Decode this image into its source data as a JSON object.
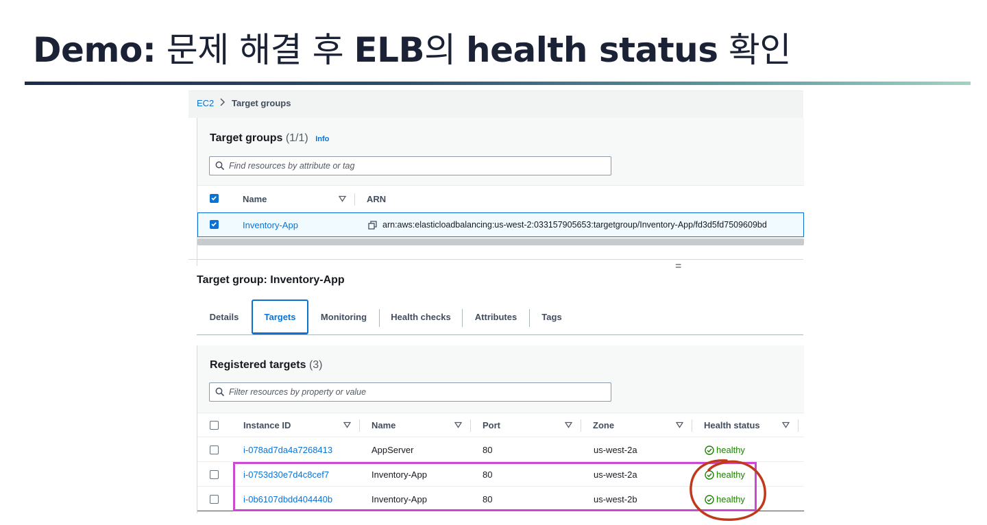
{
  "slide": {
    "title_bold_1": "Demo:",
    "title_normal_1": "문제 해결 후",
    "title_bold_2": "ELB",
    "title_normal_2": "의",
    "title_bold_3": "health status",
    "title_normal_3": "확인"
  },
  "breadcrumb": {
    "root": "EC2",
    "current": "Target groups"
  },
  "target_groups": {
    "title": "Target groups",
    "count": "(1/1)",
    "info": "Info",
    "search_placeholder": "Find resources by attribute or tag",
    "columns": [
      "Name",
      "ARN"
    ],
    "rows": [
      {
        "name": "Inventory-App",
        "arn": "arn:aws:elasticloadbalancing:us-west-2:033157905653:targetgroup/Inventory-App/fd3d5fd7509609bd",
        "selected": true
      }
    ]
  },
  "detail": {
    "title": "Target group: Inventory-App",
    "tabs": [
      "Details",
      "Targets",
      "Monitoring",
      "Health checks",
      "Attributes",
      "Tags"
    ],
    "active_tab": "Targets"
  },
  "registered_targets": {
    "title": "Registered targets",
    "count": "(3)",
    "search_placeholder": "Filter resources by property or value",
    "columns": [
      "Instance ID",
      "Name",
      "Port",
      "Zone",
      "Health status"
    ],
    "rows": [
      {
        "instance_id": "i-078ad7da4a7268413",
        "name": "AppServer",
        "port": "80",
        "zone": "us-west-2a",
        "health": "healthy"
      },
      {
        "instance_id": "i-0753d30e7d4c8cef7",
        "name": "Inventory-App",
        "port": "80",
        "zone": "us-west-2a",
        "health": "healthy"
      },
      {
        "instance_id": "i-0b6107dbdd404440b",
        "name": "Inventory-App",
        "port": "80",
        "zone": "us-west-2b",
        "health": "healthy"
      }
    ]
  },
  "colors": {
    "link": "#0972d3",
    "healthy": "#1d8102",
    "highlight_box": "#c94ad0",
    "annotation_circle": "#c0391b"
  },
  "icons": {
    "search": "search-icon",
    "copy": "copy-icon",
    "healthy": "check-circle-icon",
    "sort": "caret-down-icon",
    "breadcrumb_separator": "chevron-right-icon"
  }
}
